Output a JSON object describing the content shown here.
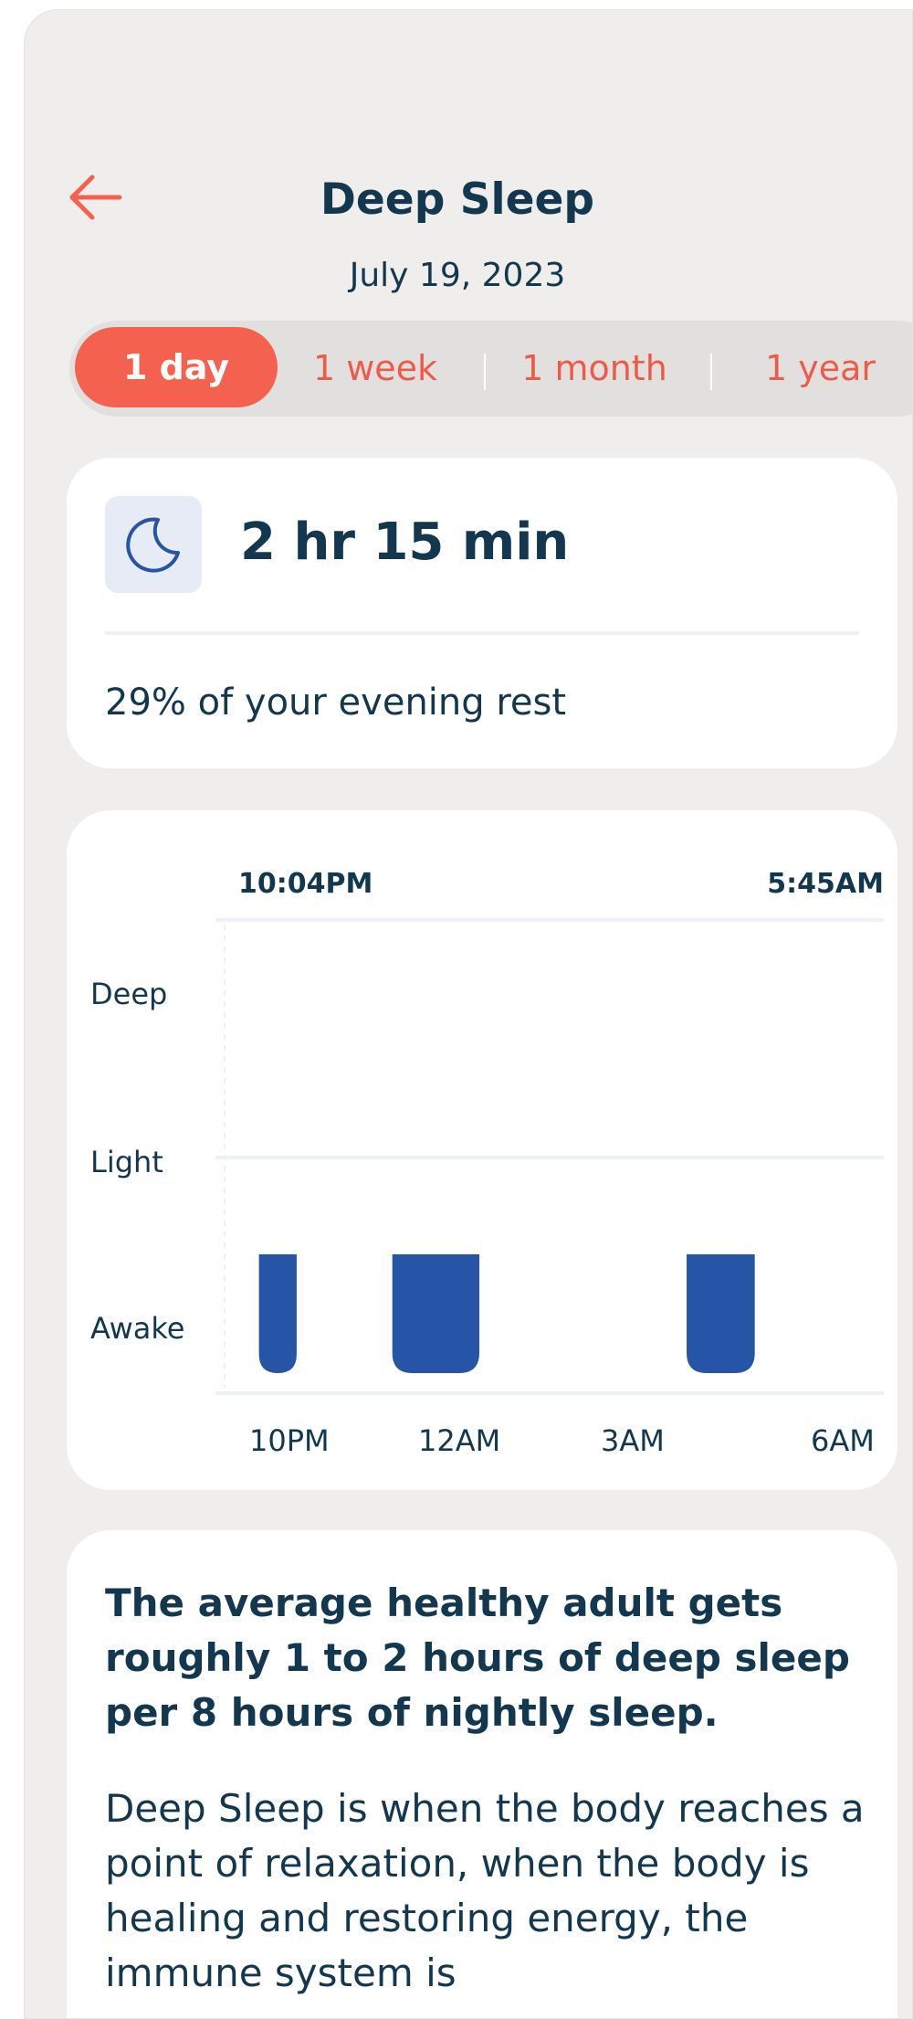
{
  "header": {
    "back_icon": "arrow-left-icon",
    "title": "Deep Sleep",
    "date": "July 19, 2023"
  },
  "colors": {
    "accent": "#f4614e",
    "text": "#13374f",
    "bar": "#2654a6",
    "background": "#f0eeec"
  },
  "range_tabs": [
    {
      "label": "1 day",
      "active": true
    },
    {
      "label": "1 week",
      "active": false
    },
    {
      "label": "1 month",
      "active": false
    },
    {
      "label": "1 year",
      "active": false
    }
  ],
  "summary": {
    "icon": "moon-icon",
    "duration": "2 hr 15 min",
    "percent_text": "29% of your evening rest"
  },
  "chart_data": {
    "type": "bar",
    "start_time": "10:04PM",
    "end_time": "5:45AM",
    "y_categories": [
      "Deep",
      "Light",
      "Awake"
    ],
    "x_tick_labels": [
      "10PM",
      "12AM",
      "3AM",
      "6AM"
    ],
    "segments": [
      {
        "start": "10:34PM",
        "end": "11:00PM",
        "stage": "Awake"
      },
      {
        "start": "12:06AM",
        "end": "1:06AM",
        "stage": "Awake"
      },
      {
        "start": "3:29AM",
        "end": "4:16AM",
        "stage": "Awake"
      }
    ],
    "grid": true
  },
  "info": {
    "heading": "The average healthy adult gets roughly 1 to 2 hours of deep sleep per 8 hours of nightly sleep.",
    "body": "Deep Sleep is when the body reaches a point of relaxation, when the body is healing and restoring energy, the immune system is"
  }
}
